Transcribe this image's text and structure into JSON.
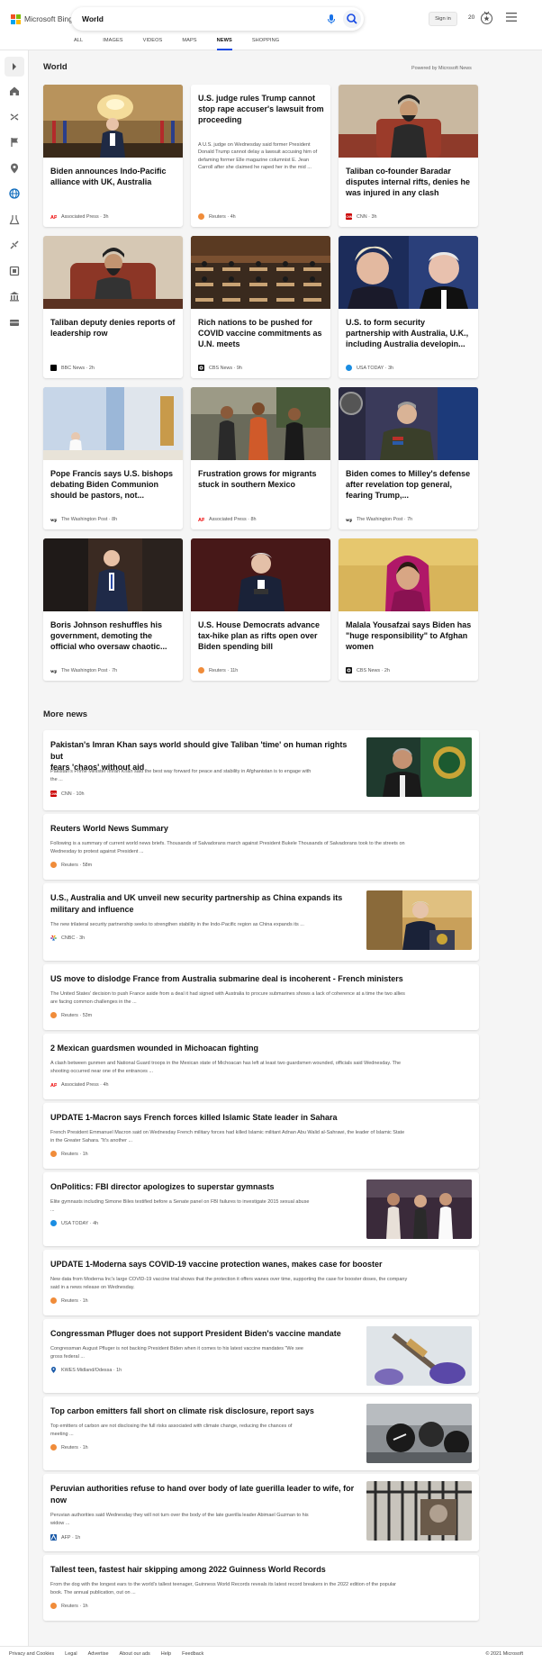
{
  "brand": {
    "name": "Microsoft Bing",
    "logo_colors": [
      "#f25022",
      "#7fba00",
      "#00a4ef",
      "#ffb900"
    ]
  },
  "search": {
    "query": "World"
  },
  "header": {
    "sign_in": "Sign in",
    "points": "20",
    "menu_icon": "hamburger-icon",
    "reward_icon": "medal-icon"
  },
  "tabs": [
    {
      "label": "ALL"
    },
    {
      "label": "IMAGES"
    },
    {
      "label": "VIDEOS"
    },
    {
      "label": "MAPS"
    },
    {
      "label": "NEWS",
      "active": true
    },
    {
      "label": "SHOPPING"
    }
  ],
  "rail_icons": [
    "chevron-right-icon",
    "home-icon",
    "us-icon",
    "flag-icon",
    "location-icon",
    "world-icon",
    "science-icon",
    "technology-icon",
    "entertainment-icon",
    "politics-icon",
    "business-icon"
  ],
  "world": {
    "title": "World",
    "powered_by": "Powered by Microsoft News",
    "cards": [
      {
        "title": "Biden announces Indo-Pacific alliance with UK, Australia",
        "source": "Associated Press",
        "age": "3h",
        "source_logo": "AP"
      },
      {
        "title": "U.S. judge rules Trump cannot stop rape accuser's lawsuit from proceeding",
        "snippet": "A U.S. judge on Wednesday said former President Donald Trump cannot delay a lawsuit accusing him of defaming former Elle magazine columnist E. Jean Carroll after she claimed he raped her in the mid ...",
        "source": "Reuters",
        "age": "4h",
        "source_logo": "reuters"
      },
      {
        "title": "Taliban co-founder Baradar disputes internal rifts, denies he was injured in any clash",
        "source": "CNN",
        "age": "3h",
        "source_logo": "CNN"
      },
      {
        "title": "Taliban deputy denies reports of leadership row",
        "source": "BBC News",
        "age": "2h",
        "source_logo": "BBC"
      },
      {
        "title": "Rich nations to be pushed for COVID vaccine commitments as U.N. meets",
        "source": "CBS News",
        "age": "9h",
        "source_logo": "CBS"
      },
      {
        "title": "U.S. to form security partnership with Australia, U.K., including Australia developin...",
        "source": "USA TODAY",
        "age": "3h",
        "source_logo": "USA"
      },
      {
        "title": "Pope Francis says U.S. bishops debating Biden Communion should be pastors, not...",
        "source": "The Washington Post",
        "age": "8h",
        "source_logo": "WP"
      },
      {
        "title": "Frustration grows for migrants stuck in southern Mexico",
        "source": "Associated Press",
        "age": "8h",
        "source_logo": "AP"
      },
      {
        "title": "Biden comes to Milley's defense after revelation top general, fearing Trump,...",
        "source": "The Washington Post",
        "age": "7h",
        "source_logo": "WP"
      },
      {
        "title": "Boris Johnson reshuffles his government, demoting the official who oversaw chaotic...",
        "source": "The Washington Post",
        "age": "7h",
        "source_logo": "WP"
      },
      {
        "title": "U.S. House Democrats advance tax-hike plan as rifts open over Biden spending bill",
        "source": "Reuters",
        "age": "11h",
        "source_logo": "reuters"
      },
      {
        "title": "Malala Yousafzai says Biden has \"huge responsibility\" to Afghan women",
        "source": "CBS News",
        "age": "2h",
        "source_logo": "CBS"
      }
    ]
  },
  "more_news": {
    "title": "More news",
    "items": [
      {
        "title_lines": [
          "Pakistan's Imran Khan says world should give Taliban 'time' on human rights but",
          "fears 'chaos' without aid"
        ],
        "snippet_lines": [
          "Pakistan's Prime Minister Imran Khan said the best way forward for peace and stability in Afghanistan is to engage with",
          "the ..."
        ],
        "source": "CNN",
        "age": "10h",
        "source_logo": "CNN",
        "thumb": true
      },
      {
        "title_lines": [
          "Reuters World News Summary"
        ],
        "snippet_lines": [
          "Following is a summary of current world news briefs. Thousands of Salvadorans march against President Bukele Thousands of Salvadorans took to the streets on",
          "Wednesday to protest against President ..."
        ],
        "source": "Reuters",
        "age": "58m",
        "source_logo": "reuters",
        "thumb": false
      },
      {
        "title_lines": [
          "U.S., Australia and UK unveil new security partnership as China expands its",
          "military and influence"
        ],
        "snippet_lines": [
          "The new trilateral security partnership seeks to strengthen stability in the Indo-Pacific region as China expands its ..."
        ],
        "source": "CNBC",
        "age": "3h",
        "source_logo": "CNBC",
        "thumb": true
      },
      {
        "title_lines": [
          "US move to dislodge France from Australia submarine deal is incoherent - French ministers"
        ],
        "snippet_lines": [
          "The United States' decision to push France aside from a deal it had signed with Australia to procure submarines shows a lack of coherence at a time the two allies",
          "are facing common challenges in the ..."
        ],
        "source": "Reuters",
        "age": "53m",
        "source_logo": "reuters",
        "thumb": false
      },
      {
        "title_lines": [
          "2 Mexican guardsmen wounded in Michoacan fighting"
        ],
        "snippet_lines": [
          "A clash between gunmen and National Guard troops in the Mexican state of Michoacan has left at least two guardsmen wounded, officials said Wednesday. The",
          "shooting occurred near one of the entrances ..."
        ],
        "source": "Associated Press",
        "age": "4h",
        "source_logo": "AP",
        "thumb": false
      },
      {
        "title_lines": [
          "UPDATE 1-Macron says French forces killed Islamic State leader in Sahara"
        ],
        "snippet_lines": [
          "French President Emmanuel Macron said on Wednesday French military forces had killed Islamic militant Adnan Abu Walid al-Sahrawi, the leader of Islamic State",
          "in the Greater Sahara. \"It's another ..."
        ],
        "source": "Reuters",
        "age": "1h",
        "source_logo": "reuters",
        "thumb": false
      },
      {
        "title_lines": [
          "OnPolitics: FBI director apologizes to superstar gymnasts"
        ],
        "snippet_lines": [
          "Elite gymnasts including Simone Biles testified before a Senate panel on FBI failures to investigate 2015 sexual abuse",
          "..."
        ],
        "source": "USA TODAY",
        "age": "4h",
        "source_logo": "USA",
        "thumb": true
      },
      {
        "title_lines": [
          "UPDATE 1-Moderna says COVID-19 vaccine protection wanes, makes case for booster"
        ],
        "snippet_lines": [
          "New data from Moderna Inc's large COVID-19 vaccine trial shows that the protection it offers wanes over time, supporting the case for booster doses, the company",
          "said in a news release on Wednesday."
        ],
        "source": "Reuters",
        "age": "1h",
        "source_logo": "reuters",
        "thumb": false
      },
      {
        "title_lines": [
          "Congressman Pfluger does not support President Biden's vaccine mandate"
        ],
        "snippet_lines": [
          "Congressman August Pfluger is not backing President Biden when it comes to his latest vaccine mandates \"We see",
          "gross federal ..."
        ],
        "source": "KWES Midland/Odessa",
        "age": "1h",
        "source_logo": "KWES",
        "thumb": true
      },
      {
        "title_lines": [
          "Top carbon emitters fall short on climate risk disclosure, report says"
        ],
        "snippet_lines": [
          "Top emitters of carbon are not disclosing the full risks associated with climate change, reducing the chances of",
          "meeting ..."
        ],
        "source": "Reuters",
        "age": "1h",
        "source_logo": "reuters",
        "thumb": true
      },
      {
        "title_lines": [
          "Peruvian authorities refuse to hand over body of late guerilla leader to wife, for",
          "now"
        ],
        "snippet_lines": [
          "Peruvian authorities said Wednesday they will not turn over the body of the late guerilla leader Abimael Guzman to his",
          "widow ..."
        ],
        "source": "AFP",
        "age": "1h",
        "source_logo": "AFP",
        "thumb": true
      },
      {
        "title_lines": [
          "Tallest teen, fastest hair skipping among 2022 Guinness World Records"
        ],
        "snippet_lines": [
          "From the dog with the longest ears to the world's tallest teenager, Guinness World Records reveals its latest record breakers in the 2022 edition of the popular",
          "book. The annual publication, out on ..."
        ],
        "source": "Reuters",
        "age": "1h",
        "source_logo": "reuters",
        "thumb": false
      }
    ]
  },
  "footer": {
    "links": [
      "Privacy and Cookies",
      "Legal",
      "Advertise",
      "About our ads",
      "Help",
      "Feedback"
    ],
    "copyright": "© 2021 Microsoft"
  },
  "colors": {
    "accent": "#174ae4",
    "reuters": "#f08c3a",
    "cnn": "#cc0000",
    "usa_today": "#1a8de2"
  }
}
